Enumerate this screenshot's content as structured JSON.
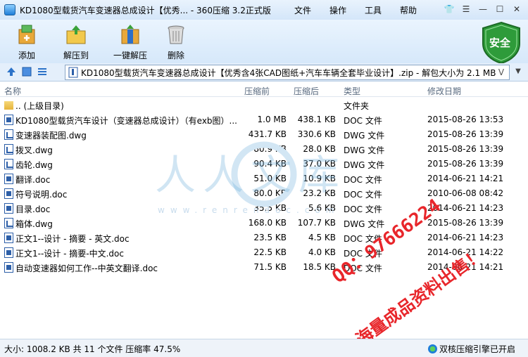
{
  "window": {
    "title": "KD1080型载货汽车变速器总成设计【优秀... - 360压缩 3.2正式版",
    "menu": [
      "文件",
      "操作",
      "工具",
      "帮助"
    ],
    "controls": [
      "👕",
      "☰",
      "—",
      "☐",
      "✕"
    ]
  },
  "toolbar": {
    "buttons": [
      "添加",
      "解压到",
      "一键解压",
      "删除"
    ],
    "shield_label": "安全"
  },
  "address": {
    "path": "KD1080型载货汽车变速器总成设计【优秀含4张CAD图纸+汽车车辆全套毕业设计】.zip - 解包大小为 2.1 MB",
    "dropdown": "V"
  },
  "columns": [
    "名称",
    "压缩前",
    "压缩后",
    "类型",
    "修改日期"
  ],
  "files": [
    {
      "icon": "folder",
      "name": ".. (上级目录)",
      "size": "",
      "csize": "",
      "type": "文件夹",
      "date": ""
    },
    {
      "icon": "doc",
      "name": "KD1080型载货汽车设计（变速器总成设计）（有exb图）...",
      "size": "1.0 MB",
      "csize": "438.1 KB",
      "type": "DOC 文件",
      "date": "2015-08-26 13:53"
    },
    {
      "icon": "dwg",
      "name": "变速器装配图.dwg",
      "size": "431.7 KB",
      "csize": "330.6 KB",
      "type": "DWG 文件",
      "date": "2015-08-26 13:39"
    },
    {
      "icon": "dwg",
      "name": "拨叉.dwg",
      "size": "80.9 KB",
      "csize": "28.0 KB",
      "type": "DWG 文件",
      "date": "2015-08-26 13:39"
    },
    {
      "icon": "dwg",
      "name": "齿轮.dwg",
      "size": "90.4 KB",
      "csize": "37.0 KB",
      "type": "DWG 文件",
      "date": "2015-08-26 13:39"
    },
    {
      "icon": "doc",
      "name": "翻译.doc",
      "size": "51.0 KB",
      "csize": "10.9 KB",
      "type": "DOC 文件",
      "date": "2014-06-21 14:21"
    },
    {
      "icon": "doc",
      "name": "符号说明.doc",
      "size": "80.0 KB",
      "csize": "23.2 KB",
      "type": "DOC 文件",
      "date": "2010-06-08 08:42"
    },
    {
      "icon": "doc",
      "name": "目录.doc",
      "size": "35.5 KB",
      "csize": "5.6 KB",
      "type": "DOC 文件",
      "date": "2014-06-21 14:23"
    },
    {
      "icon": "dwg",
      "name": "箱体.dwg",
      "size": "168.0 KB",
      "csize": "107.7 KB",
      "type": "DWG 文件",
      "date": "2015-08-26 13:39"
    },
    {
      "icon": "doc",
      "name": "正文1--设计 - 摘要 - 英文.doc",
      "size": "23.5 KB",
      "csize": "4.5 KB",
      "type": "DOC 文件",
      "date": "2014-06-21 14:23"
    },
    {
      "icon": "doc",
      "name": "正文1--设计 - 摘要-中文.doc",
      "size": "22.5 KB",
      "csize": "4.0 KB",
      "type": "DOC 文件",
      "date": "2014-06-21 14:22"
    },
    {
      "icon": "doc",
      "name": "自动变速器如何工作--中英文翻译.doc",
      "size": "71.5 KB",
      "csize": "18.5 KB",
      "type": "DOC 文件",
      "date": "2014-06-21 14:21"
    }
  ],
  "watermark": {
    "text": "人人文库",
    "url": "www.renrendoc.com"
  },
  "promo": {
    "qq": "QQ：97666224",
    "slogan": "海量成品资料出售！"
  },
  "status": {
    "summary": "大小: 1008.2 KB 共 11 个文件 压缩率 47.5%",
    "engine": "双核压缩引擎已开启"
  },
  "colors": {
    "accent": "#1e7ed8",
    "promo": "#e8262b",
    "shield": "#2e9b3a"
  }
}
